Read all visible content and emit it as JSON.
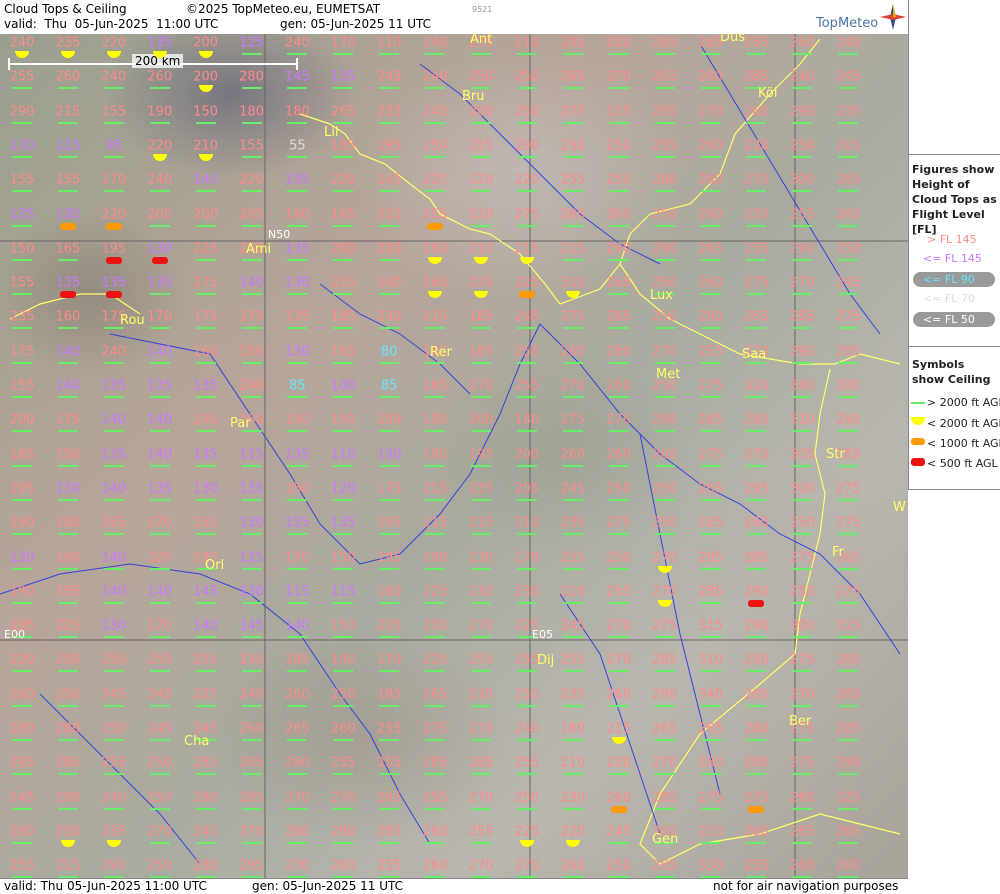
{
  "header": {
    "title": "Cloud Tops & Ceiling",
    "copyright": "©2025 TopMeteo.eu, EUMETSAT",
    "valid_label": "valid:",
    "valid_day": "Thu",
    "valid_date": "05-Jun-2025",
    "valid_time": "11:00 UTC",
    "gen": "gen: 05-Jun-2025 11 UTC",
    "code": "9521",
    "brand": "TopMeteo"
  },
  "footer": {
    "valid": "valid:  Thu  05-Jun-2025  11:00 UTC",
    "gen": "gen: 05-Jun-2025 11 UTC",
    "note": "not for air navigation purposes"
  },
  "scale_label": "200 km",
  "grid_labels": [
    "N50",
    "E00",
    "E05"
  ],
  "cities": [
    "Ant",
    "Düs",
    "Bru",
    "Köl",
    "Lil",
    "Ami",
    "Lux",
    "Rou",
    "Rer",
    "Saa",
    "Met",
    "Par",
    "Str",
    "W",
    "Orl",
    "Fr",
    "Dij",
    "Cha",
    "Ber",
    "Gen"
  ],
  "legend": {
    "title": "Figures show Height of Cloud Tops as Flight Level [FL]",
    "levels": [
      {
        "text": "> FL 145",
        "color": "#ff8a8a"
      },
      {
        "text": "<= FL 145",
        "color": "#cc77ff"
      },
      {
        "text": "<= FL 90",
        "color": "#66e6ff"
      },
      {
        "text": "<= FL 70",
        "color": "#dddddd"
      },
      {
        "text": "<= FL 50",
        "color": "#ffffff"
      }
    ],
    "symbols_title": "Symbols show Ceiling",
    "symbols": [
      {
        "text": "> 2000 ft AGL",
        "color": "#66ee66"
      },
      {
        "text": "< 2000 ft AGL",
        "color": "#ffff00"
      },
      {
        "text": "< 1000 ft AGL",
        "color": "#ff9900"
      },
      {
        "text": "< 500 ft AGL",
        "color": "#ee1111"
      }
    ]
  },
  "grid": {
    "rows": [
      [
        240,
        235,
        220,
        135,
        200,
        125,
        240,
        170,
        210,
        240,
        235,
        210,
        245,
        220,
        265,
        265,
        255,
        260,
        240
      ],
      [
        255,
        260,
        240,
        260,
        200,
        280,
        145,
        135,
        245,
        240,
        250,
        250,
        265,
        270,
        265,
        260,
        285,
        240,
        245
      ],
      [
        290,
        215,
        155,
        190,
        150,
        180,
        180,
        265,
        235,
        245,
        200,
        250,
        270,
        310,
        255,
        270,
        260,
        290,
        235
      ],
      [
        130,
        115,
        95,
        220,
        210,
        155,
        55,
        185,
        195,
        250,
        255,
        290,
        230,
        250,
        255,
        260,
        230,
        250,
        265
      ],
      [
        155,
        155,
        170,
        240,
        140,
        220,
        135,
        220,
        245,
        225,
        220,
        220,
        255,
        250,
        260,
        260,
        275,
        300,
        265
      ],
      [
        135,
        130,
        220,
        205,
        200,
        205,
        190,
        165,
        215,
        255,
        220,
        275,
        260,
        300,
        250,
        260,
        235,
        255,
        260
      ],
      [
        150,
        165,
        195,
        130,
        225,
        230,
        135,
        280,
        220,
        160,
        210,
        215,
        215,
        290,
        290,
        265,
        255,
        290,
        250
      ],
      [
        155,
        135,
        135,
        135,
        175,
        140,
        130,
        215,
        240,
        160,
        220,
        225,
        310,
        265,
        250,
        260,
        275,
        270,
        245
      ],
      [
        235,
        160,
        175,
        170,
        175,
        175,
        175,
        185,
        230,
        215,
        185,
        245,
        275,
        285,
        250,
        290,
        265,
        285,
        275
      ],
      [
        175,
        140,
        240,
        140,
        160,
        150,
        130,
        165,
        80,
        165,
        185,
        255,
        260,
        280,
        270,
        255,
        270,
        290,
        285
      ],
      [
        155,
        140,
        135,
        135,
        135,
        240,
        85,
        100,
        85,
        165,
        170,
        255,
        270,
        260,
        250,
        275,
        310,
        340,
        300
      ],
      [
        200,
        175,
        140,
        140,
        190,
        160,
        150,
        150,
        150,
        195,
        200,
        180,
        275,
        270,
        280,
        285,
        285,
        310,
        290
      ],
      [
        185,
        150,
        135,
        140,
        135,
        115,
        135,
        110,
        130,
        195,
        195,
        200,
        260,
        260,
        260,
        275,
        275,
        305,
        285
      ],
      [
        195,
        130,
        140,
        135,
        130,
        135,
        150,
        120,
        175,
        215,
        235,
        205,
        245,
        250,
        250,
        265,
        295,
        300,
        275
      ],
      [
        190,
        180,
        165,
        170,
        165,
        130,
        125,
        135,
        195,
        215,
        215,
        210,
        235,
        275,
        250,
        285,
        260,
        250,
        275
      ],
      [
        130,
        160,
        140,
        220,
        195,
        115,
        170,
        150,
        195,
        200,
        230,
        170,
        255,
        250,
        270,
        295,
        285,
        275,
        265
      ],
      [
        190,
        155,
        140,
        140,
        145,
        130,
        115,
        115,
        160,
        225,
        230,
        230,
        210,
        255,
        270,
        285,
        290,
        250,
        275
      ],
      [
        195,
        225,
        130,
        170,
        140,
        145,
        140,
        150,
        205,
        230,
        270,
        225,
        245,
        270,
        275,
        315,
        290,
        300,
        315
      ],
      [
        220,
        250,
        250,
        255,
        255,
        190,
        185,
        190,
        170,
        225,
        255,
        255,
        255,
        270,
        285,
        310,
        290,
        275,
        260
      ],
      [
        260,
        250,
        245,
        245,
        225,
        240,
        260,
        250,
        185,
        265,
        235,
        250,
        235,
        260,
        290,
        340,
        285,
        270,
        285
      ],
      [
        280,
        280,
        250,
        245,
        245,
        260,
        265,
        260,
        255,
        275,
        270,
        240,
        180,
        215,
        265,
        265,
        280,
        275,
        285
      ],
      [
        295,
        285,
        255,
        250,
        285,
        265,
        260,
        255,
        255,
        285,
        285,
        255,
        210,
        220,
        270,
        280,
        280,
        275,
        290
      ],
      [
        245,
        280,
        240,
        250,
        280,
        285,
        270,
        270,
        265,
        255,
        270,
        250,
        230,
        260,
        285,
        275,
        275,
        260,
        325
      ],
      [
        280,
        250,
        235,
        270,
        240,
        270,
        280,
        280,
        285,
        260,
        255,
        225,
        220,
        245,
        300,
        210,
        260,
        265,
        265
      ],
      [
        255,
        215,
        290,
        250,
        280,
        295,
        270,
        260,
        255,
        260,
        270,
        270,
        260,
        250,
        265,
        330,
        255,
        260,
        260
      ]
    ],
    "symbols": {
      "0": {
        "0": "y",
        "1": "y",
        "2": "y",
        "3": "y",
        "4": "y"
      },
      "1": {
        "4": "y"
      },
      "3": {
        "3": "y",
        "4": "y"
      },
      "5": {
        "1": "o",
        "2": "o",
        "9": "o"
      },
      "6": {
        "2": "r",
        "3": "r",
        "9": "y",
        "10": "y",
        "11": "y"
      },
      "7": {
        "1": "r",
        "2": "r",
        "9": "y",
        "10": "y",
        "11": "o",
        "12": "y"
      },
      "15": {
        "14": "y"
      },
      "16": {
        "14": "y",
        "16": "r"
      },
      "15b": {},
      "20": {
        "13": "y"
      },
      "22": {
        "13": "o",
        "16": "o"
      },
      "23": {
        "1": "y",
        "2": "y",
        "11": "y",
        "12": "y"
      }
    }
  }
}
